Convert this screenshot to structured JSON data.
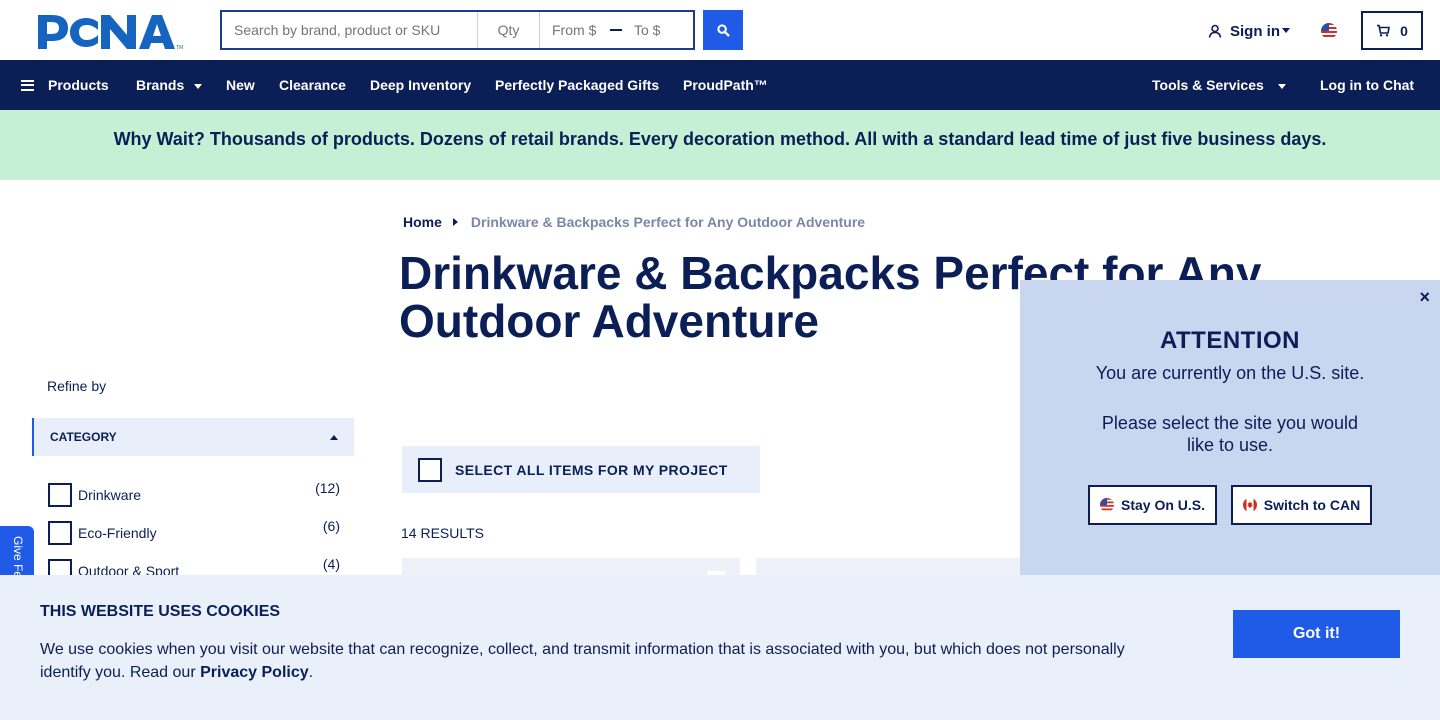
{
  "header": {
    "logo_text": "PCNA",
    "search": {
      "placeholder": "Search by brand, product or SKU",
      "qty_placeholder": "Qty",
      "from_placeholder": "From $",
      "to_placeholder": "To $"
    },
    "sign_in": "Sign in",
    "cart_count": "0"
  },
  "nav": {
    "products": "Products",
    "brands": "Brands",
    "new": "New",
    "clearance": "Clearance",
    "deep_inventory": "Deep Inventory",
    "gifts": "Perfectly Packaged Gifts",
    "proudpath": "ProudPath™",
    "tools": "Tools & Services",
    "chat": "Log in to Chat"
  },
  "banner": {
    "text": "Why Wait? Thousands of products. Dozens of retail brands. Every decoration method. All with a standard lead time of just five business days."
  },
  "breadcrumb": {
    "home": "Home",
    "current": "Drinkware & Backpacks Perfect for Any Outdoor Adventure"
  },
  "page_title": "Drinkware & Backpacks Perfect for Any Outdoor Adventure",
  "sidebar": {
    "refine_by": "Refine by",
    "category_header": "CATEGORY",
    "categories": [
      {
        "label": "Drinkware",
        "count": "(12)"
      },
      {
        "label": "Eco-Friendly",
        "count": "(6)"
      },
      {
        "label": "Outdoor & Sport",
        "count": "(4)"
      }
    ]
  },
  "feedback_tab": "Give Feedback",
  "select_all": "SELECT ALL ITEMS FOR MY PROJECT",
  "results": "14 RESULTS",
  "attention": {
    "close": "×",
    "title": "ATTENTION",
    "line1": "You are currently on the U.S. site.",
    "line2": "Please select the site you would like to use.",
    "stay_us": "Stay On U.S.",
    "switch_can": "Switch to CAN"
  },
  "cookie": {
    "heading": "THIS WEBSITE USES COOKIES",
    "text": "We use cookies when you visit our website that can recognize, collect, and transmit information that is associated with you, but which does not personally identify you. Read our",
    "link": "Privacy Policy",
    "period": ".",
    "button": "Got it!"
  },
  "colors": {
    "navy": "#0b1f56",
    "blue": "#1f5be7",
    "banner_green": "#c6f0d5",
    "popup_blue": "#c9d6f0",
    "cookie_bg": "#eaf0fa"
  }
}
